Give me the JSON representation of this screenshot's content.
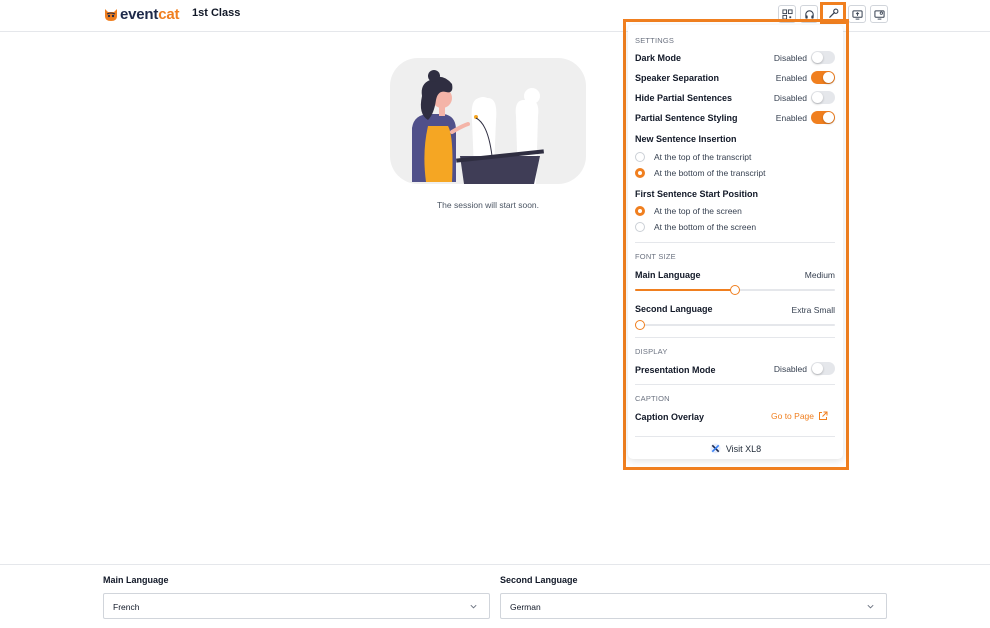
{
  "header": {
    "logo_word_1": "event",
    "logo_word_2": "cat",
    "session_title": "1st Class",
    "icons": [
      "qr-code-icon",
      "headphones-icon",
      "wrench-icon",
      "share-screen-icon",
      "display-settings-icon"
    ]
  },
  "main": {
    "waiting_message": "The session will start soon."
  },
  "settings_panel": {
    "settings_heading": "SETTINGS",
    "dark_mode": {
      "label": "Dark Mode",
      "value": "Disabled",
      "on": false
    },
    "speaker_separation": {
      "label": "Speaker Separation",
      "value": "Enabled",
      "on": true
    },
    "hide_partial": {
      "label": "Hide Partial Sentences",
      "value": "Disabled",
      "on": false
    },
    "partial_styling": {
      "label": "Partial Sentence Styling",
      "value": "Enabled",
      "on": true
    },
    "new_sentence": {
      "label": "New Sentence Insertion",
      "options": [
        "At the top of the transcript",
        "At the bottom of the transcript"
      ],
      "selected": 1
    },
    "first_sentence": {
      "label": "First Sentence Start Position",
      "options": [
        "At the top of the screen",
        "At the bottom of the screen"
      ],
      "selected": 0
    },
    "font_size_heading": "FONT SIZE",
    "main_language": {
      "label": "Main Language",
      "value": "Medium",
      "level": 0.5
    },
    "second_language": {
      "label": "Second Language",
      "value": "Extra Small",
      "level": 0.0
    },
    "display_heading": "DISPLAY",
    "presentation_mode": {
      "label": "Presentation Mode",
      "value": "Disabled",
      "on": false
    },
    "caption_heading": "CAPTION",
    "caption_overlay": {
      "label": "Caption Overlay",
      "link": "Go to Page"
    },
    "visit_label": "Visit XL8"
  },
  "footer": {
    "main_language_label": "Main Language",
    "main_language_value": "French",
    "second_language_label": "Second Language",
    "second_language_value": "German"
  },
  "colors": {
    "accent": "#f07f1f",
    "navy": "#1e2a4a"
  }
}
